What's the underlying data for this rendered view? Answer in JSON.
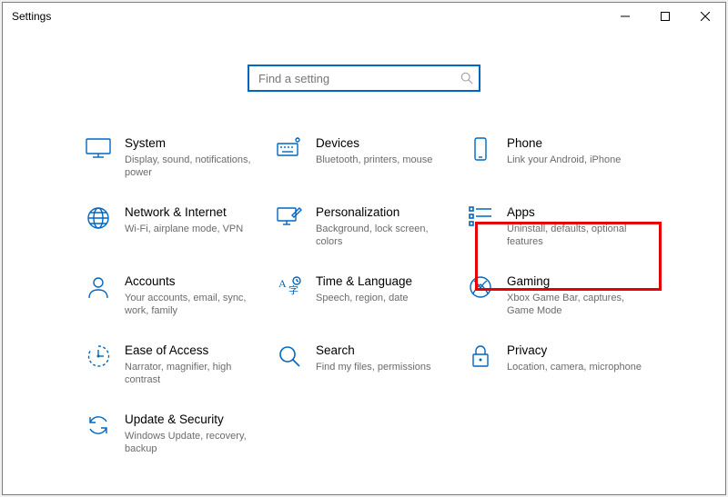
{
  "window": {
    "title": "Settings",
    "minimize": "—",
    "maximize": "☐",
    "close": "✕"
  },
  "search": {
    "placeholder": "Find a setting"
  },
  "tiles": {
    "system": {
      "title": "System",
      "desc": "Display, sound, notifications, power"
    },
    "devices": {
      "title": "Devices",
      "desc": "Bluetooth, printers, mouse"
    },
    "phone": {
      "title": "Phone",
      "desc": "Link your Android, iPhone"
    },
    "network": {
      "title": "Network & Internet",
      "desc": "Wi-Fi, airplane mode, VPN"
    },
    "personalization": {
      "title": "Personalization",
      "desc": "Background, lock screen, colors"
    },
    "apps": {
      "title": "Apps",
      "desc": "Uninstall, defaults, optional features"
    },
    "accounts": {
      "title": "Accounts",
      "desc": "Your accounts, email, sync, work, family"
    },
    "time": {
      "title": "Time & Language",
      "desc": "Speech, region, date"
    },
    "gaming": {
      "title": "Gaming",
      "desc": "Xbox Game Bar, captures, Game Mode"
    },
    "ease": {
      "title": "Ease of Access",
      "desc": "Narrator, magnifier, high contrast"
    },
    "search_tile": {
      "title": "Search",
      "desc": "Find my files, permissions"
    },
    "privacy": {
      "title": "Privacy",
      "desc": "Location, camera, microphone"
    },
    "update": {
      "title": "Update & Security",
      "desc": "Windows Update, recovery, backup"
    }
  }
}
